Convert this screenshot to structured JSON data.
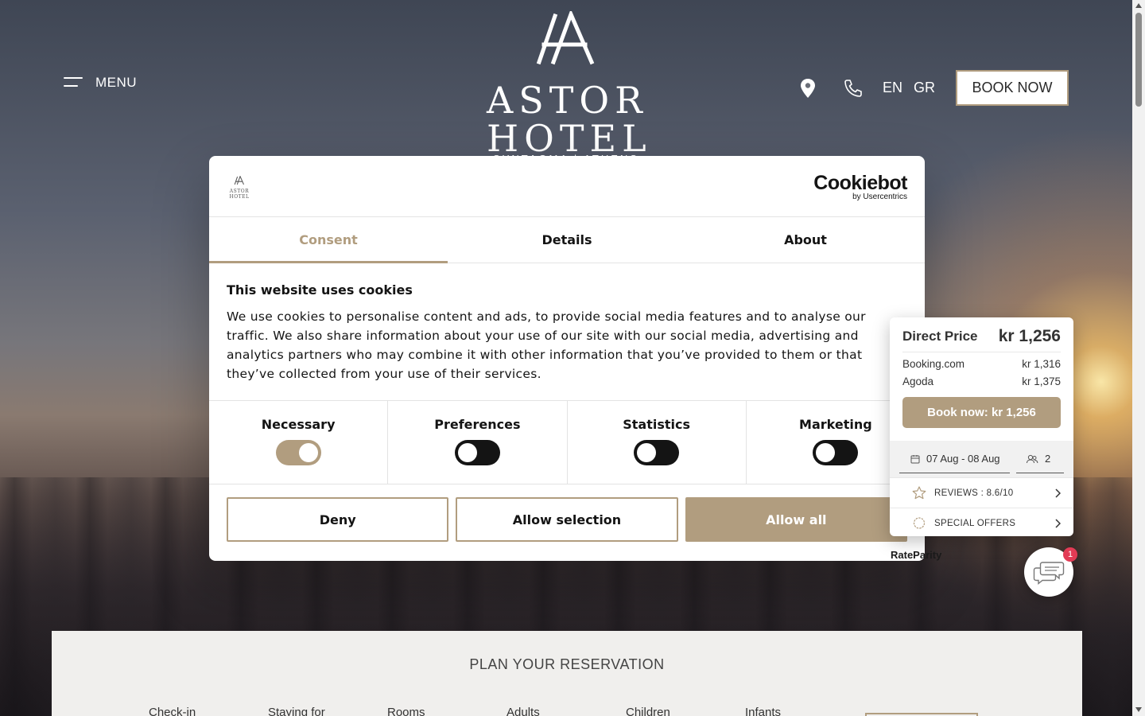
{
  "header": {
    "menu_label": "MENU",
    "logo_line1": "ASTOR",
    "logo_line2": "HOTEL",
    "logo_sub": "SYNTAGMA | ATHENS",
    "lang_en": "EN",
    "lang_gr": "GR",
    "book_now": "BOOK NOW"
  },
  "cookie": {
    "brand": "Cookiebot",
    "brand_by": "by Usercentrics",
    "tabs": [
      {
        "label": "Consent",
        "active": true
      },
      {
        "label": "Details",
        "active": false
      },
      {
        "label": "About",
        "active": false
      }
    ],
    "title": "This website uses cookies",
    "text": "We use cookies to personalise content and ads, to provide social media features and to analyse our traffic. We also share information about your use of our site with our social media, advertising and analytics partners who may combine it with other information that you’ve provided to them or that they’ve collected from your use of their services.",
    "categories": [
      {
        "label": "Necessary",
        "checked": true
      },
      {
        "label": "Preferences",
        "checked": false
      },
      {
        "label": "Statistics",
        "checked": false
      },
      {
        "label": "Marketing",
        "checked": false
      }
    ],
    "buttons": {
      "deny": "Deny",
      "allow_selection": "Allow selection",
      "allow_all": "Allow all"
    }
  },
  "rate_widget": {
    "direct_label": "Direct Price",
    "direct_price": "kr 1,256",
    "ota": [
      {
        "name": "Booking.com",
        "price": "kr 1,316"
      },
      {
        "name": "Agoda",
        "price": "kr 1,375"
      }
    ],
    "book_label": "Book now: kr 1,256",
    "dates": "07 Aug - 08 Aug",
    "guests": "2",
    "reviews": "REVIEWS : 8.6/10",
    "offers": "SPECIAL OFFERS",
    "brand": "RateParity"
  },
  "chat": {
    "badge": "1"
  },
  "plan": {
    "title": "PLAN YOUR RESERVATION",
    "fields": [
      "Check-in",
      "Staying for",
      "Rooms",
      "Adults",
      "Children",
      "Infants"
    ]
  },
  "colors": {
    "accent": "#b19d7f",
    "text": "#141414",
    "badge": "#e23b55"
  }
}
